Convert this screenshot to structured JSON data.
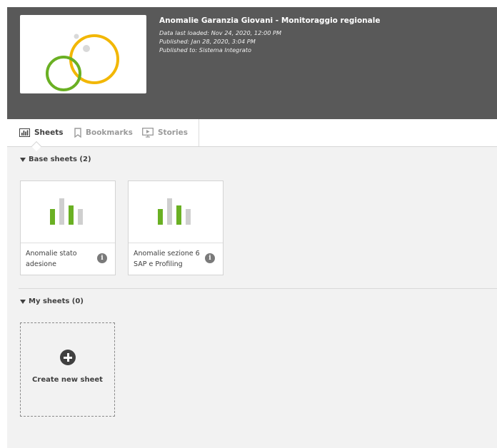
{
  "header": {
    "title": "Anomalie Garanzia Giovani - Monitoraggio regionale",
    "data_last_loaded": "Data last loaded: Nov 24, 2020, 12:00 PM",
    "published": "Published: Jan 28, 2020, 3:04 PM",
    "published_to": "Published to: Sistema Integrato",
    "thumbnail_icon": "app-logo-circles"
  },
  "tabs": [
    {
      "label": "Sheets",
      "icon": "sheets-icon",
      "active": true
    },
    {
      "label": "Bookmarks",
      "icon": "bookmark-icon",
      "active": false
    },
    {
      "label": "Stories",
      "icon": "stories-icon",
      "active": false
    }
  ],
  "base_sheets": {
    "header": "Base sheets (2)",
    "items": [
      {
        "title": "Anomalie stato adesione",
        "icon": "sheet-chart-icon"
      },
      {
        "title": "Anomalie sezione 6 SAP e Profiling",
        "icon": "sheet-chart-icon"
      }
    ]
  },
  "my_sheets": {
    "header": "My sheets (0)",
    "create_label": "Create new sheet"
  },
  "colors": {
    "header_bg": "#595959",
    "panel_bg": "#f2f2f2",
    "green": "#6ab023",
    "yellow": "#f2b705",
    "bar_grey": "#cfcfcf"
  }
}
